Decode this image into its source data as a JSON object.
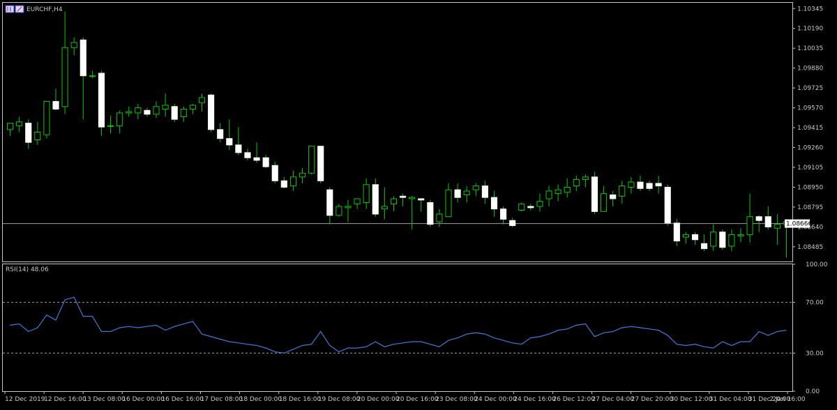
{
  "header": {
    "symbol_label": "EURCHF,H4",
    "icon": "chart-type-icon"
  },
  "rsi_header": {
    "label": "RSI(14) 48.06"
  },
  "current_price_label": "1.08666",
  "colors": {
    "background": "#000000",
    "frame": "#c8c8c8",
    "bull_body": "#000000",
    "bear_body": "#ffffff",
    "wick": "#00cc00",
    "price_line": "#a0a0a0",
    "rsi_line": "#3b7ddd",
    "level_line": "#a0a0a0"
  },
  "chart_data": [
    {
      "type": "candlestick",
      "title": "EURCHF,H4",
      "ylim": [
        1.0837,
        1.1039
      ],
      "y_ticks": [
        "1.10345",
        "1.10190",
        "1.10035",
        "1.09880",
        "1.09725",
        "1.09570",
        "1.09415",
        "1.09260",
        "1.09105",
        "1.08950",
        "1.08795",
        "1.08640",
        "1.08485"
      ],
      "x_ticks": [
        "12 Dec 2019",
        "12 Dec 16:00",
        "13 Dec 08:00",
        "16 Dec 00:00",
        "16 Dec 16:00",
        "17 Dec 08:00",
        "18 Dec 00:00",
        "18 Dec 16:00",
        "19 Dec 08:00",
        "20 Dec 00:00",
        "20 Dec 16:00",
        "23 Dec 08:00",
        "24 Dec 00:00",
        "24 Dec 16:00",
        "26 Dec 12:00",
        "27 Dec 04:00",
        "27 Dec 20:00",
        "30 Dec 12:00",
        "31 Dec 04:00",
        "31 Dec 20:00",
        "2 Jan 16:00"
      ],
      "current_price": 1.08666,
      "candles": [
        [
          1.094,
          1.0945,
          1.0935,
          1.0945
        ],
        [
          1.0943,
          1.095,
          1.0938,
          1.0946
        ],
        [
          1.0945,
          1.0948,
          1.0925,
          1.093
        ],
        [
          1.0932,
          1.0946,
          1.0928,
          1.0938
        ],
        [
          1.0936,
          1.0962,
          1.0933,
          1.0962
        ],
        [
          1.0962,
          1.0972,
          1.0955,
          1.0956
        ],
        [
          1.0958,
          1.1032,
          1.0952,
          1.1004
        ],
        [
          1.1004,
          1.1012,
          1.0998,
          1.1008
        ],
        [
          1.101,
          1.1012,
          1.0948,
          1.0982
        ],
        [
          1.0982,
          1.0986,
          1.098,
          1.0982
        ],
        [
          1.0984,
          1.0986,
          1.0935,
          1.0942
        ],
        [
          1.0943,
          1.0951,
          1.0937,
          1.0943
        ],
        [
          1.0943,
          1.0955,
          1.0937,
          1.0953
        ],
        [
          1.0953,
          1.0958,
          1.095,
          1.0954
        ],
        [
          1.0953,
          1.096,
          1.0948,
          1.0957
        ],
        [
          1.0955,
          1.0957,
          1.095,
          1.0952
        ],
        [
          1.0952,
          1.0962,
          1.0949,
          1.0958
        ],
        [
          1.0956,
          1.0968,
          1.095,
          1.0959
        ],
        [
          1.0958,
          1.096,
          1.0946,
          1.0948
        ],
        [
          1.095,
          1.0958,
          1.0946,
          1.0956
        ],
        [
          1.0956,
          1.096,
          1.0952,
          1.0959
        ],
        [
          1.0961,
          1.0968,
          1.0954,
          1.0965
        ],
        [
          1.0967,
          1.0968,
          1.0938,
          1.094
        ],
        [
          1.094,
          1.0945,
          1.093,
          1.0933
        ],
        [
          1.0933,
          1.0948,
          1.0924,
          1.0928
        ],
        [
          1.0928,
          1.0942,
          1.092,
          1.0922
        ],
        [
          1.0922,
          1.0925,
          1.0916,
          1.0918
        ],
        [
          1.0918,
          1.093,
          1.0914,
          1.0916
        ],
        [
          1.0918,
          1.092,
          1.091,
          1.0911
        ],
        [
          1.0912,
          1.0915,
          1.0898,
          1.09
        ],
        [
          1.09,
          1.0903,
          1.0894,
          1.0895
        ],
        [
          1.0896,
          1.0908,
          1.0892,
          1.0903
        ],
        [
          1.0903,
          1.091,
          1.0898,
          1.0906
        ],
        [
          1.0906,
          1.0927,
          1.0905,
          1.0927
        ],
        [
          1.0927,
          1.0927,
          1.0898,
          1.09
        ],
        [
          1.0893,
          1.0895,
          1.0866,
          1.0873
        ],
        [
          1.0873,
          1.0882,
          1.0872,
          1.088
        ],
        [
          1.0879,
          1.0885,
          1.0868,
          1.088
        ],
        [
          1.0882,
          1.0886,
          1.0878,
          1.0886
        ],
        [
          1.0883,
          1.0902,
          1.0878,
          1.0897
        ],
        [
          1.0897,
          1.0902,
          1.0872,
          1.0874
        ],
        [
          1.0878,
          1.0895,
          1.087,
          1.088
        ],
        [
          1.0882,
          1.0888,
          1.0876,
          1.0886
        ],
        [
          1.0888,
          1.089,
          1.088,
          1.0887
        ],
        [
          1.0886,
          1.0888,
          1.0862,
          1.0887
        ],
        [
          1.0886,
          1.0886,
          1.0876,
          1.0885
        ],
        [
          1.0883,
          1.0885,
          1.0864,
          1.0866
        ],
        [
          1.0868,
          1.0878,
          1.0864,
          1.0874
        ],
        [
          1.0872,
          1.0898,
          1.0872,
          1.0893
        ],
        [
          1.0893,
          1.0898,
          1.0883,
          1.0887
        ],
        [
          1.0889,
          1.0896,
          1.0883,
          1.0892
        ],
        [
          1.0893,
          1.0898,
          1.0888,
          1.0896
        ],
        [
          1.0896,
          1.09,
          1.0882,
          1.0887
        ],
        [
          1.0887,
          1.0892,
          1.0872,
          1.0878
        ],
        [
          1.0878,
          1.088,
          1.0866,
          1.087
        ],
        [
          1.0869,
          1.0871,
          1.0864,
          1.0865
        ],
        [
          1.0877,
          1.0883,
          1.0876,
          1.0882
        ],
        [
          1.088,
          1.0882,
          1.0877,
          1.0879
        ],
        [
          1.088,
          1.089,
          1.0876,
          1.0884
        ],
        [
          1.0886,
          1.0896,
          1.088,
          1.0892
        ],
        [
          1.089,
          1.0897,
          1.0884,
          1.0893
        ],
        [
          1.0891,
          1.0902,
          1.0887,
          1.0895
        ],
        [
          1.0896,
          1.0904,
          1.0892,
          1.0901
        ],
        [
          1.0901,
          1.0905,
          1.0895,
          1.0903
        ],
        [
          1.0903,
          1.0907,
          1.0874,
          1.0876
        ],
        [
          1.0876,
          1.0896,
          1.0876,
          1.089
        ],
        [
          1.0889,
          1.0892,
          1.088,
          1.0886
        ],
        [
          1.0888,
          1.09,
          1.0882,
          1.0896
        ],
        [
          1.0895,
          1.0903,
          1.089,
          1.0899
        ],
        [
          1.0899,
          1.0904,
          1.0892,
          1.0894
        ],
        [
          1.0898,
          1.09,
          1.0892,
          1.0894
        ],
        [
          1.0898,
          1.0904,
          1.089,
          1.0896
        ],
        [
          1.0895,
          1.0897,
          1.0865,
          1.0867
        ],
        [
          1.0867,
          1.087,
          1.0849,
          1.0853
        ],
        [
          1.0856,
          1.086,
          1.0851,
          1.0858
        ],
        [
          1.0858,
          1.086,
          1.085,
          1.0854
        ],
        [
          1.0851,
          1.0858,
          1.0845,
          1.0847
        ],
        [
          1.0849,
          1.0866,
          1.0845,
          1.086
        ],
        [
          1.086,
          1.0862,
          1.0846,
          1.0848
        ],
        [
          1.0849,
          1.0862,
          1.0845,
          1.0858
        ],
        [
          1.0857,
          1.0863,
          1.0852,
          1.0858
        ],
        [
          1.0858,
          1.089,
          1.0852,
          1.0872
        ],
        [
          1.0872,
          1.0873,
          1.086,
          1.0869
        ],
        [
          1.0872,
          1.088,
          1.0862,
          1.0864
        ],
        [
          1.0863,
          1.0874,
          1.085,
          1.0866
        ],
        [
          1.0866,
          1.087,
          1.084,
          1.0868
        ]
      ]
    },
    {
      "type": "line",
      "title": "RSI(14) 48.06",
      "ylim": [
        0,
        100
      ],
      "y_ticks": [
        "100.00",
        "70.00",
        "30.00",
        "0.00"
      ],
      "levels": [
        70,
        30
      ],
      "values": [
        52,
        53,
        47,
        50,
        60,
        56,
        72,
        74,
        59,
        59,
        47,
        47,
        50,
        51,
        50,
        51,
        52,
        48,
        51,
        53,
        55,
        45,
        43,
        41,
        39,
        38,
        37,
        36,
        34,
        31,
        30,
        33,
        36,
        37,
        47,
        36,
        31,
        34,
        34,
        35,
        39,
        35,
        37,
        38,
        39,
        39,
        37,
        35,
        40,
        42,
        45,
        46,
        45,
        42,
        40,
        38,
        37,
        42,
        43,
        45,
        48,
        49,
        52,
        53,
        43,
        46,
        47,
        50,
        51,
        50,
        49,
        48,
        44,
        37,
        36,
        37,
        35,
        34,
        39,
        36,
        39,
        39,
        47,
        44,
        47,
        48
      ]
    }
  ]
}
